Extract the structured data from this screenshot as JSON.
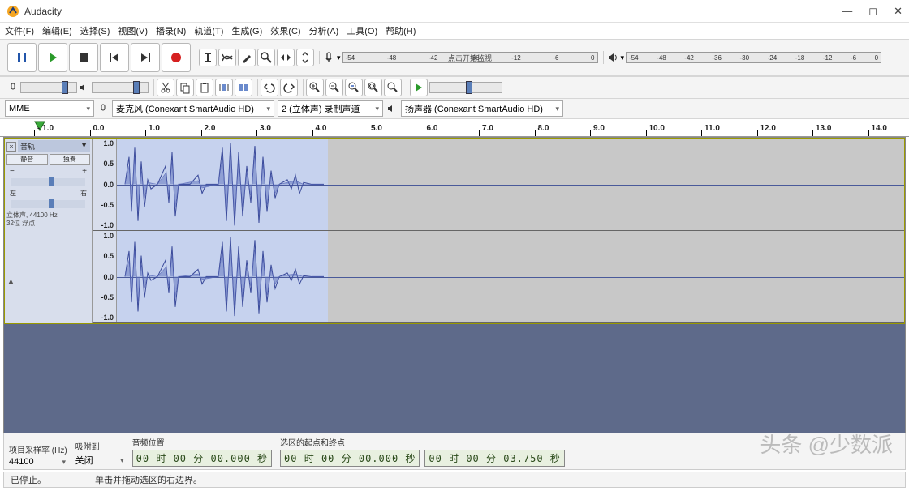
{
  "app": {
    "title": "Audacity"
  },
  "menu": [
    "文件(F)",
    "编辑(E)",
    "选择(S)",
    "视图(V)",
    "播录(N)",
    "轨道(T)",
    "生成(G)",
    "效果(C)",
    "分析(A)",
    "工具(O)",
    "帮助(H)"
  ],
  "transport": {
    "pause": "pause",
    "play": "play",
    "stop": "stop",
    "skip_start": "skip-start",
    "skip_end": "skip-end",
    "record": "record"
  },
  "meters": {
    "rec_placeholder": "点击开始监视",
    "ticks": [
      "-54",
      "-48",
      "-42",
      "-36",
      "-30",
      "-24",
      "-18",
      "-12",
      "-6",
      "0"
    ]
  },
  "devices": {
    "host": "MME",
    "input": "麦克风 (Conexant SmartAudio HD)",
    "channels": "2 (立体声) 录制声道",
    "output": "扬声器 (Conexant SmartAudio HD)"
  },
  "ruler": {
    "values": [
      "- 1.0",
      "0.0",
      "1.0",
      "2.0",
      "3.0",
      "4.0",
      "5.0",
      "6.0",
      "7.0",
      "8.0",
      "9.0",
      "10.0",
      "11.0",
      "12.0",
      "13.0",
      "14.0"
    ]
  },
  "track": {
    "name": "音轨",
    "mute": "静音",
    "solo": "独奏",
    "info1": "立体声, 44100 Hz",
    "info2": "32位 浮点",
    "scale": [
      "1.0",
      "0.5",
      "0.0",
      "-0.5",
      "-1.0"
    ]
  },
  "bottom": {
    "rate_label": "项目采样率 (Hz)",
    "rate": "44100",
    "snap_label": "吸附到",
    "snap": "关闭",
    "pos_label": "音频位置",
    "pos": "00 时 00 分 00.000 秒",
    "sel_label": "选区的起点和终点",
    "sel_start": "00 时 00 分 00.000 秒",
    "sel_end": "00 时 00 分 03.750 秒"
  },
  "status": {
    "state": "已停止。",
    "hint": "单击并拖动选区的右边界。"
  },
  "watermark": "头条 @少数派"
}
